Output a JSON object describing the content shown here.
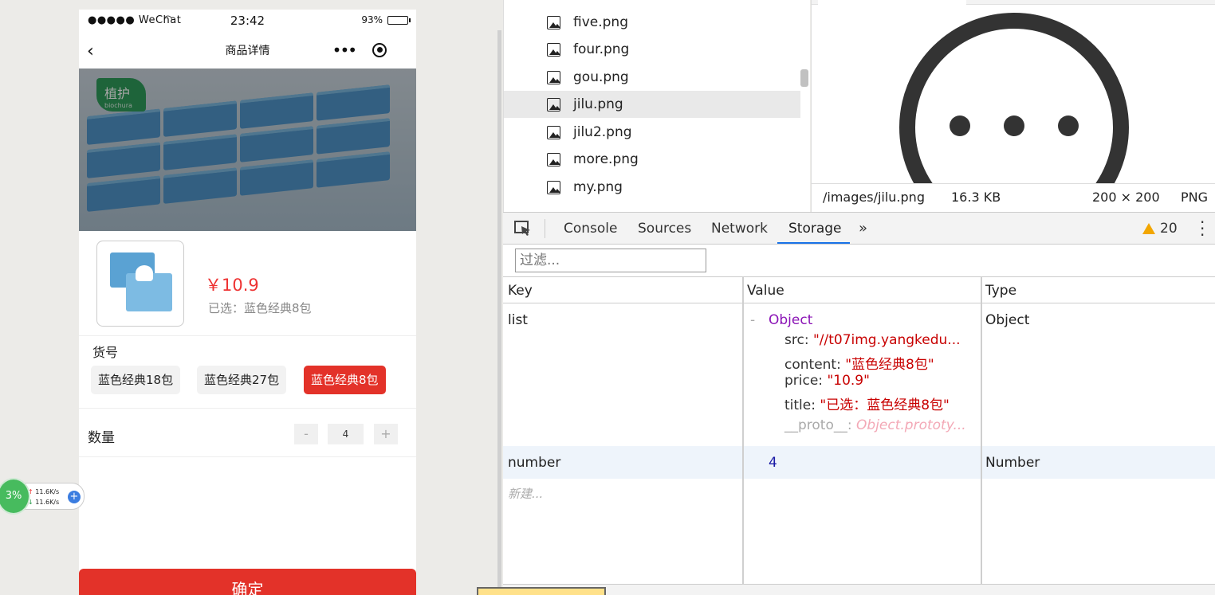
{
  "phone": {
    "status": {
      "signal": "●●●●● WeChat",
      "time": "23:42",
      "battery": "93%",
      "battery_level": 0.93
    },
    "nav": {
      "back": "‹",
      "title": "商品详情"
    },
    "hero": {
      "brand": "植护",
      "brand_en": "biochura"
    },
    "product": {
      "price": "￥10.9",
      "selected": "已选：蓝色经典8包"
    },
    "spec": {
      "label": "货号",
      "options": [
        "蓝色经典18包",
        "蓝色经典27包",
        "蓝色经典8包"
      ],
      "active_index": 2
    },
    "quantity": {
      "label": "数量",
      "minus": "-",
      "value": "4",
      "plus": "+"
    },
    "confirm": "确定"
  },
  "netwidget": {
    "percent": "3%",
    "up": "11.6K/s",
    "down": "11.6K/s",
    "plus": "+"
  },
  "files": {
    "items": [
      "five.png",
      "four.png",
      "gou.png",
      "jilu.png",
      "jilu2.png",
      "more.png",
      "my.png"
    ],
    "selected": "jilu.png"
  },
  "preview": {
    "path": "/images/jilu.png",
    "size": "16.3 KB",
    "dimensions": "200 × 200",
    "format": "PNG"
  },
  "tabs": {
    "items": [
      "Console",
      "Sources",
      "Network",
      "Storage"
    ],
    "active": "Storage",
    "more": "»",
    "warning_count": "20"
  },
  "filter": {
    "placeholder": "过滤..."
  },
  "storage": {
    "headers": {
      "key": "Key",
      "value": "Value",
      "type": "Type"
    },
    "rows": [
      {
        "key": "list",
        "toggle": "-",
        "value_type": "Object",
        "type": "Object",
        "fields": [
          {
            "name": "src: ",
            "value": "\"//t07img.yangkedu...",
            "kind": "string"
          },
          {
            "name": "content: ",
            "value": "\"蓝色经典8包\"",
            "kind": "string"
          },
          {
            "name": "price: ",
            "value": "\"10.9\"",
            "kind": "string"
          },
          {
            "name": "title: ",
            "value": "\"已选：蓝色经典8包\"",
            "kind": "string"
          },
          {
            "name": "__proto__: ",
            "value": "Object.prototy...",
            "kind": "proto"
          }
        ]
      },
      {
        "key": "number",
        "value": "4",
        "type": "Number"
      }
    ],
    "new_entry": "新建..."
  },
  "colors": {
    "accent_red": "#e33229",
    "tab_blue": "#1a73e8",
    "object_purple": "#8b14b6",
    "string_red": "#c80000"
  }
}
